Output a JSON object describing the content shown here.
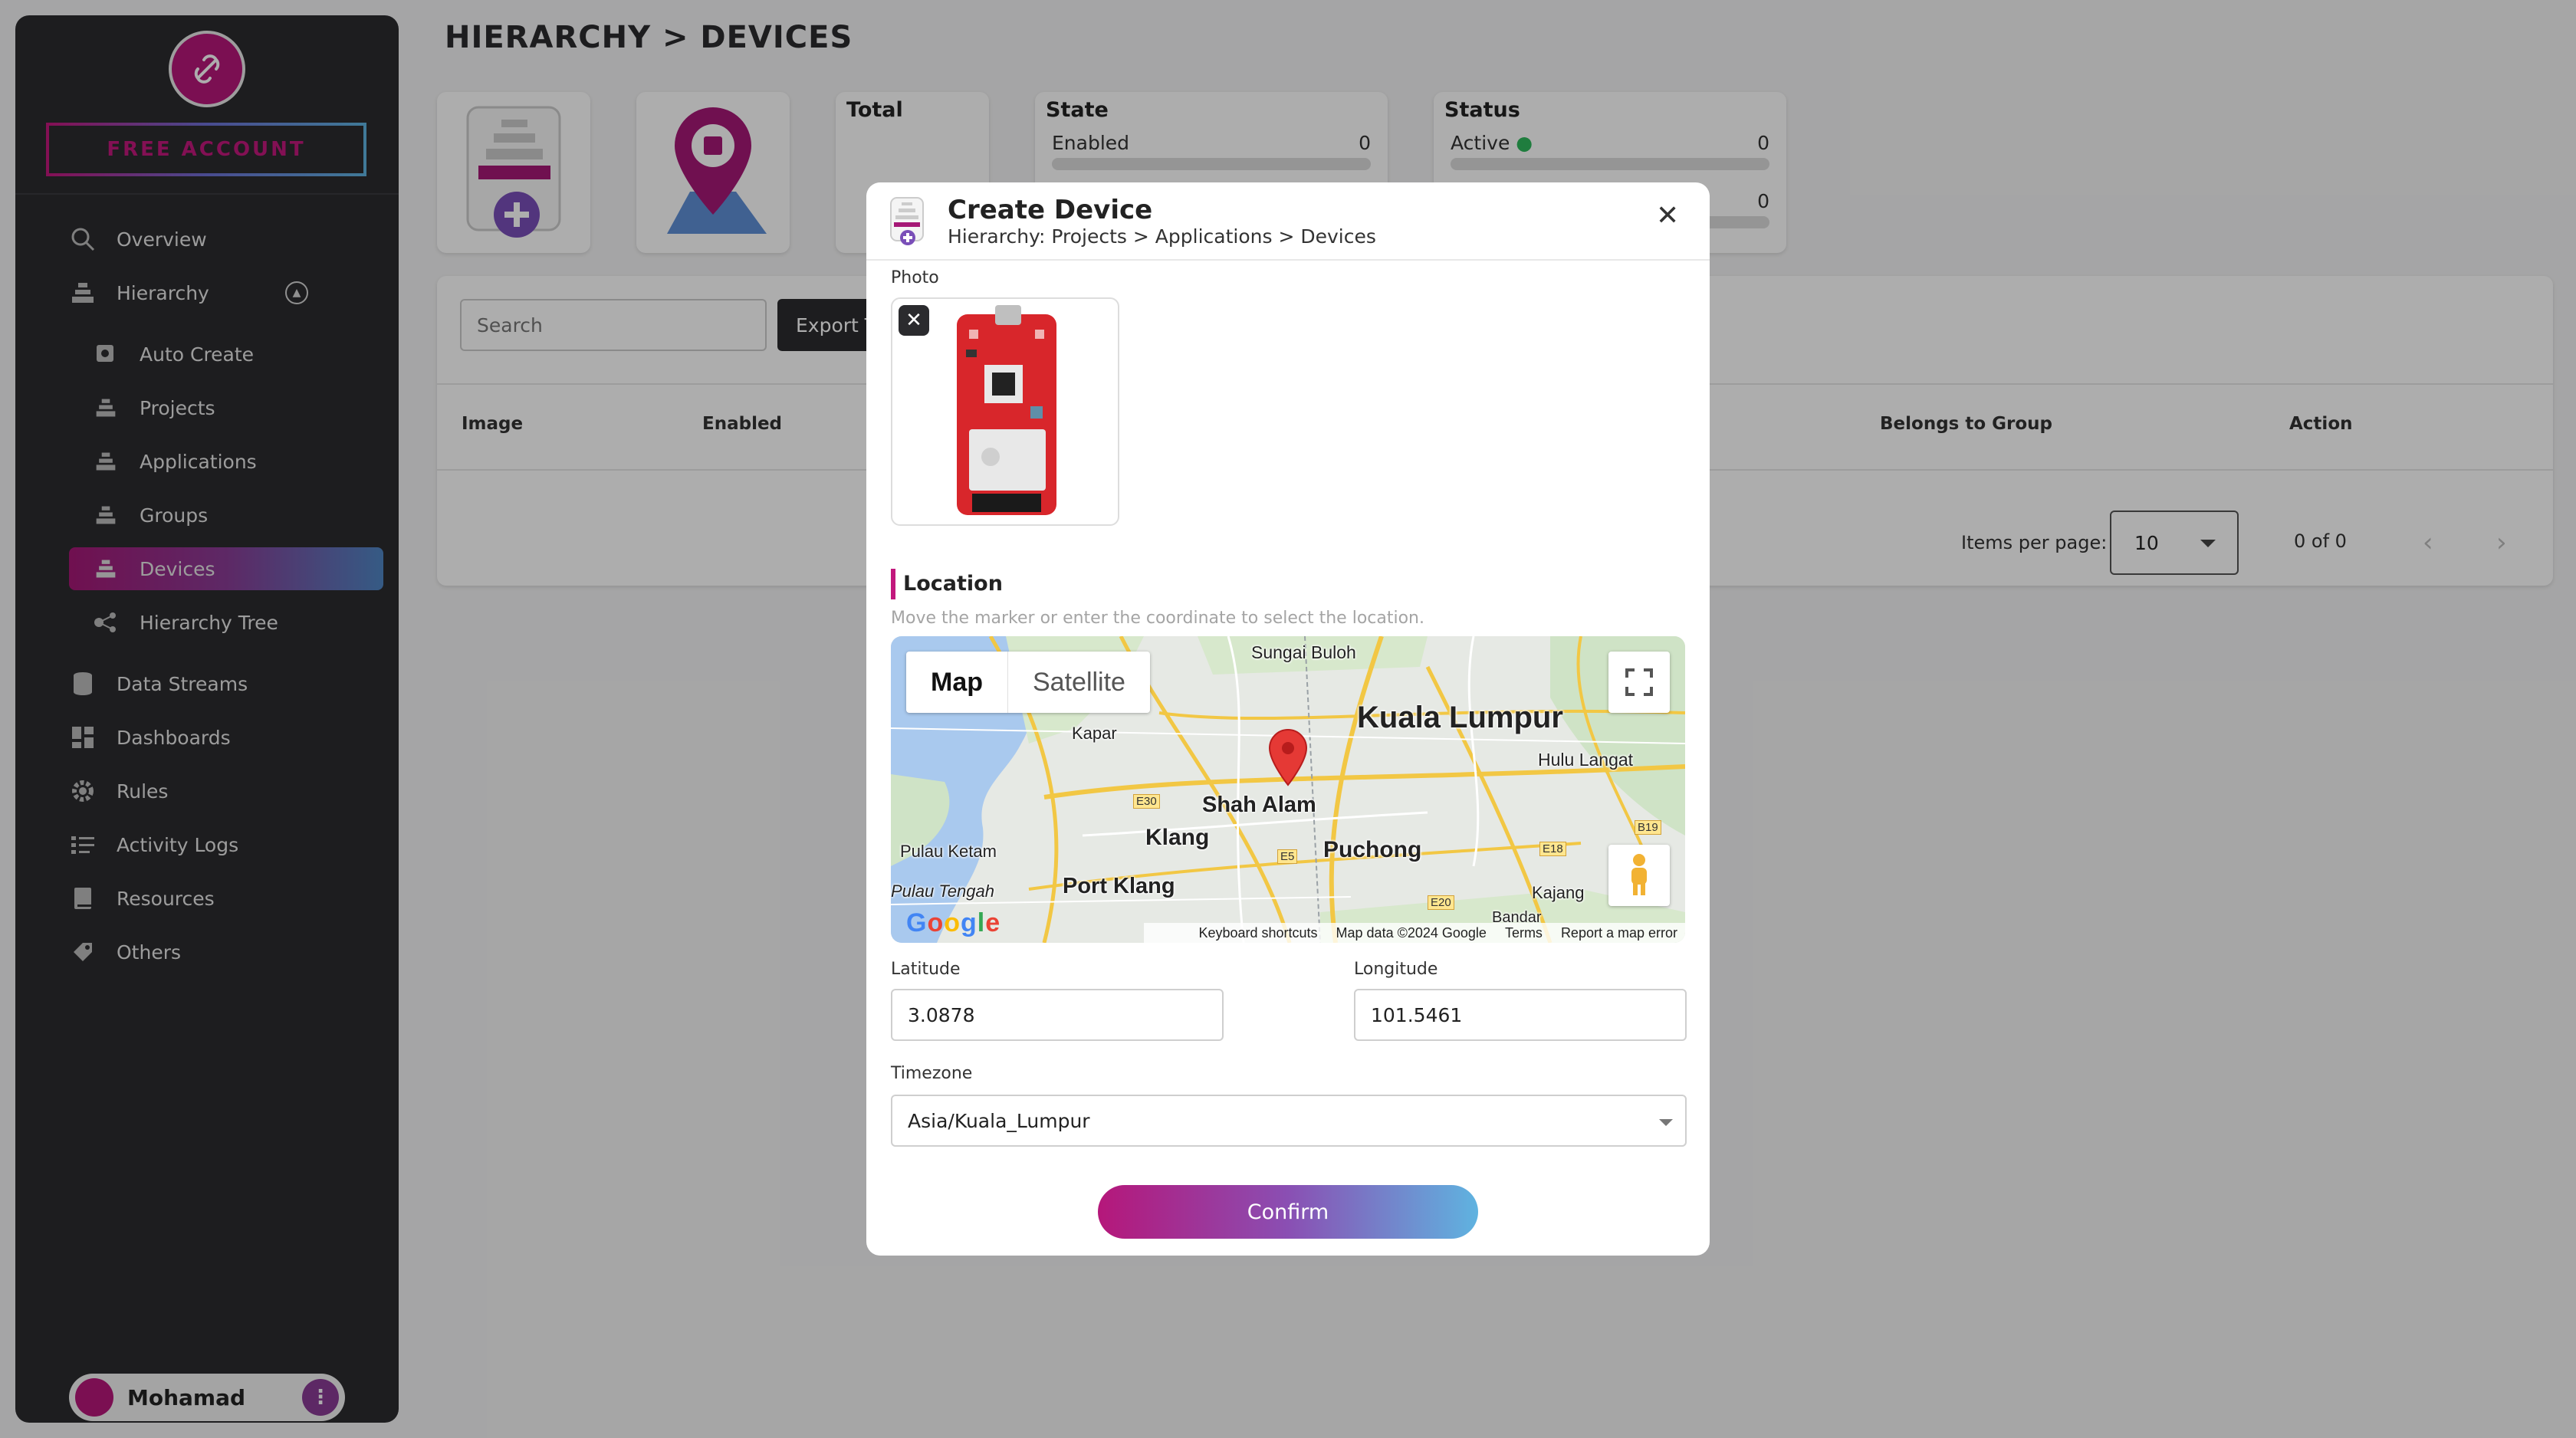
{
  "sidebar": {
    "account_badge": "FREE ACCOUNT",
    "items": [
      {
        "label": "Overview",
        "icon": "search-icon"
      },
      {
        "label": "Hierarchy",
        "icon": "hierarchy-icon"
      },
      {
        "label": "Auto Create",
        "icon": "auto-create-icon"
      },
      {
        "label": "Projects",
        "icon": "hierarchy-icon"
      },
      {
        "label": "Applications",
        "icon": "hierarchy-icon"
      },
      {
        "label": "Groups",
        "icon": "hierarchy-icon"
      },
      {
        "label": "Devices",
        "icon": "hierarchy-icon",
        "active": true
      },
      {
        "label": "Hierarchy Tree",
        "icon": "tree-icon"
      },
      {
        "label": "Data Streams",
        "icon": "database-icon"
      },
      {
        "label": "Dashboards",
        "icon": "dashboard-icon"
      },
      {
        "label": "Rules",
        "icon": "gear-icon"
      },
      {
        "label": "Activity Logs",
        "icon": "list-icon"
      },
      {
        "label": "Resources",
        "icon": "book-icon"
      },
      {
        "label": "Others",
        "icon": "tag-icon"
      }
    ],
    "user": {
      "name": "Mohamad",
      "menu": "⋮"
    }
  },
  "main": {
    "title": "HIERARCHY > DEVICES",
    "total_title": "Total",
    "state": {
      "title": "State",
      "label": "Enabled",
      "value": "0"
    },
    "status": {
      "title": "Status",
      "label": "Active",
      "value": "0",
      "second_value": "0"
    },
    "search_placeholder": "Search",
    "export_label": "Export Template",
    "columns": [
      "Image",
      "Enabled",
      "Belongs to Group",
      "Action"
    ],
    "items_per_page_label": "Items per page:",
    "items_per_page": "10",
    "range": "0 of 0",
    "prev": "‹",
    "next": "›"
  },
  "modal": {
    "title": "Create Device",
    "breadcrumb": "Hierarchy: Projects > Applications > Devices",
    "close": "✕",
    "photo_label": "Photo",
    "photo_remove": "✕",
    "location_title": "Location",
    "location_hint": "Move the marker or enter the coordinate to select the location.",
    "map": {
      "tab_map": "Map",
      "tab_satellite": "Satellite",
      "places": {
        "sungai_buloh": "Sungai Buloh",
        "kuala_lumpur": "Kuala Lumpur",
        "kapar": "Kapar",
        "hulu_langat": "Hulu Langat",
        "shah_alam": "Shah Alam",
        "pulau_ketam": "Pulau Ketam",
        "klang": "Klang",
        "puchong": "Puchong",
        "pulau_tengah": "Pulau Tengah",
        "port_klang": "Port Klang",
        "kajang": "Kajang",
        "bandar": "Bandar"
      },
      "roads": {
        "e30": "E30",
        "e5": "E5",
        "e18": "E18",
        "e20": "E20",
        "b19": "B19"
      },
      "footer": {
        "shortcuts": "Keyboard shortcuts",
        "data": "Map data ©2024 Google",
        "terms": "Terms",
        "report": "Report a map error"
      }
    },
    "latitude_label": "Latitude",
    "latitude": "3.0878",
    "longitude_label": "Longitude",
    "longitude": "101.5461",
    "timezone_label": "Timezone",
    "timezone": "Asia/Kuala_Lumpur",
    "confirm": "Confirm"
  }
}
